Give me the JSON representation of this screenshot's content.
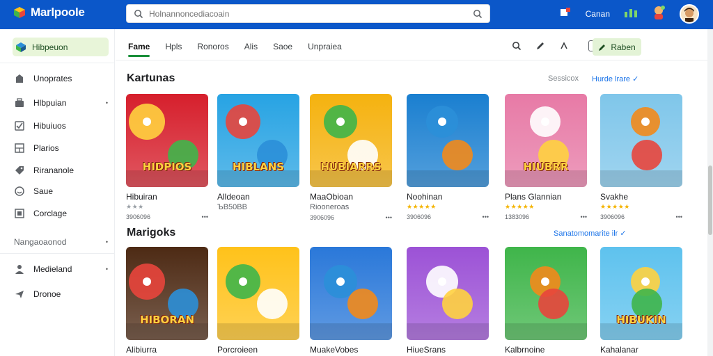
{
  "app": {
    "name": "Marlpoole"
  },
  "search": {
    "placeholder": "Holnannoncediacoain"
  },
  "topbar": {
    "account_label": "Canan"
  },
  "sidebar": {
    "home_label": "Hibpeuon",
    "items_top": [
      {
        "label": "Unoprates",
        "icon": "bag-icon"
      },
      {
        "label": "Hlbpuian",
        "icon": "briefcase-icon",
        "chevron": true
      },
      {
        "label": "Hibuiuos",
        "icon": "checkbox-icon"
      },
      {
        "label": "Plarios",
        "icon": "grid-icon"
      },
      {
        "label": "Rirananole",
        "icon": "tag-icon"
      },
      {
        "label": "Saue",
        "icon": "smiley-icon"
      },
      {
        "label": "Corclage",
        "icon": "square-letter-icon"
      }
    ],
    "section_label": "Nangaoaonod",
    "items_bottom": [
      {
        "label": "Medieland",
        "icon": "person-icon",
        "chevron": true
      },
      {
        "label": "Dronoe",
        "icon": "send-icon"
      }
    ]
  },
  "tabs": [
    {
      "label": "Fame",
      "active": true
    },
    {
      "label": "Hpls"
    },
    {
      "label": "Ronoros"
    },
    {
      "label": "Alis"
    },
    {
      "label": "Saoe"
    },
    {
      "label": "Unpraiea"
    }
  ],
  "toolbar": {
    "action_label": "Raben"
  },
  "sections": [
    {
      "title": "Kartunas",
      "subtitle": "Sessicox",
      "more_label": "Hurde lrare ✓",
      "cards": [
        {
          "name": "Hibuiran",
          "rating": "★★★",
          "stars_gray": true,
          "meta": "3906096",
          "thumb_text": "HIDPIOS",
          "bg": "#d61f2c"
        },
        {
          "name": "Alldeoan",
          "rating": "",
          "meta": "",
          "sub": "ЪВ50ВВ",
          "thumb_text": "HIBLANS",
          "bg": "#27a3e3"
        },
        {
          "name": "MaaObioan",
          "rating": "",
          "meta": "3906096",
          "sub": "Riooneroas",
          "thumb_text": "HUBIARRS",
          "bg": "#f5b20f"
        },
        {
          "name": "Noohinan",
          "rating": "★★★★★",
          "meta": "3906096",
          "thumb_text": "",
          "bg": "#1a7fd0"
        },
        {
          "name": "Plans Glannian",
          "rating": "★★★★★",
          "meta": "1383096",
          "thumb_text": "HIUBRR",
          "bg": "#e77aa6"
        },
        {
          "name": "Svakhe",
          "rating": "★★★★★",
          "meta": "3906096",
          "thumb_text": "",
          "bg": "#7fc6ea"
        }
      ]
    },
    {
      "title": "Marigoks",
      "subtitle": "",
      "more_label": "Sanatomomarite ilr ✓",
      "cards": [
        {
          "name": "Alibiurra",
          "rating": "",
          "meta": "",
          "thumb_text": "HIBORAN",
          "bg": "#4d2a14"
        },
        {
          "name": "Porcroieen",
          "rating": "",
          "meta": "",
          "thumb_text": "",
          "bg": "#ffc21a"
        },
        {
          "name": "MuakeVobes",
          "rating": "",
          "meta": "",
          "thumb_text": "",
          "bg": "#2a78d9"
        },
        {
          "name": "HiueSrans",
          "rating": "★★★★★",
          "meta": "",
          "thumb_text": "",
          "bg": "#9c52d6"
        },
        {
          "name": "Kalbrnoine",
          "rating": "★★★★★",
          "meta": "",
          "thumb_text": "",
          "bg": "#3fb54a"
        },
        {
          "name": "Kahalanar",
          "rating": "★★★★★",
          "meta": "",
          "thumb_text": "HIBUKIN",
          "bg": "#5ec2ee"
        }
      ]
    }
  ],
  "colors": {
    "topbar": "#0b57c9",
    "accent_green": "#1a8f3a",
    "home_bg": "#e8f5d9",
    "link": "#1a73e8"
  }
}
